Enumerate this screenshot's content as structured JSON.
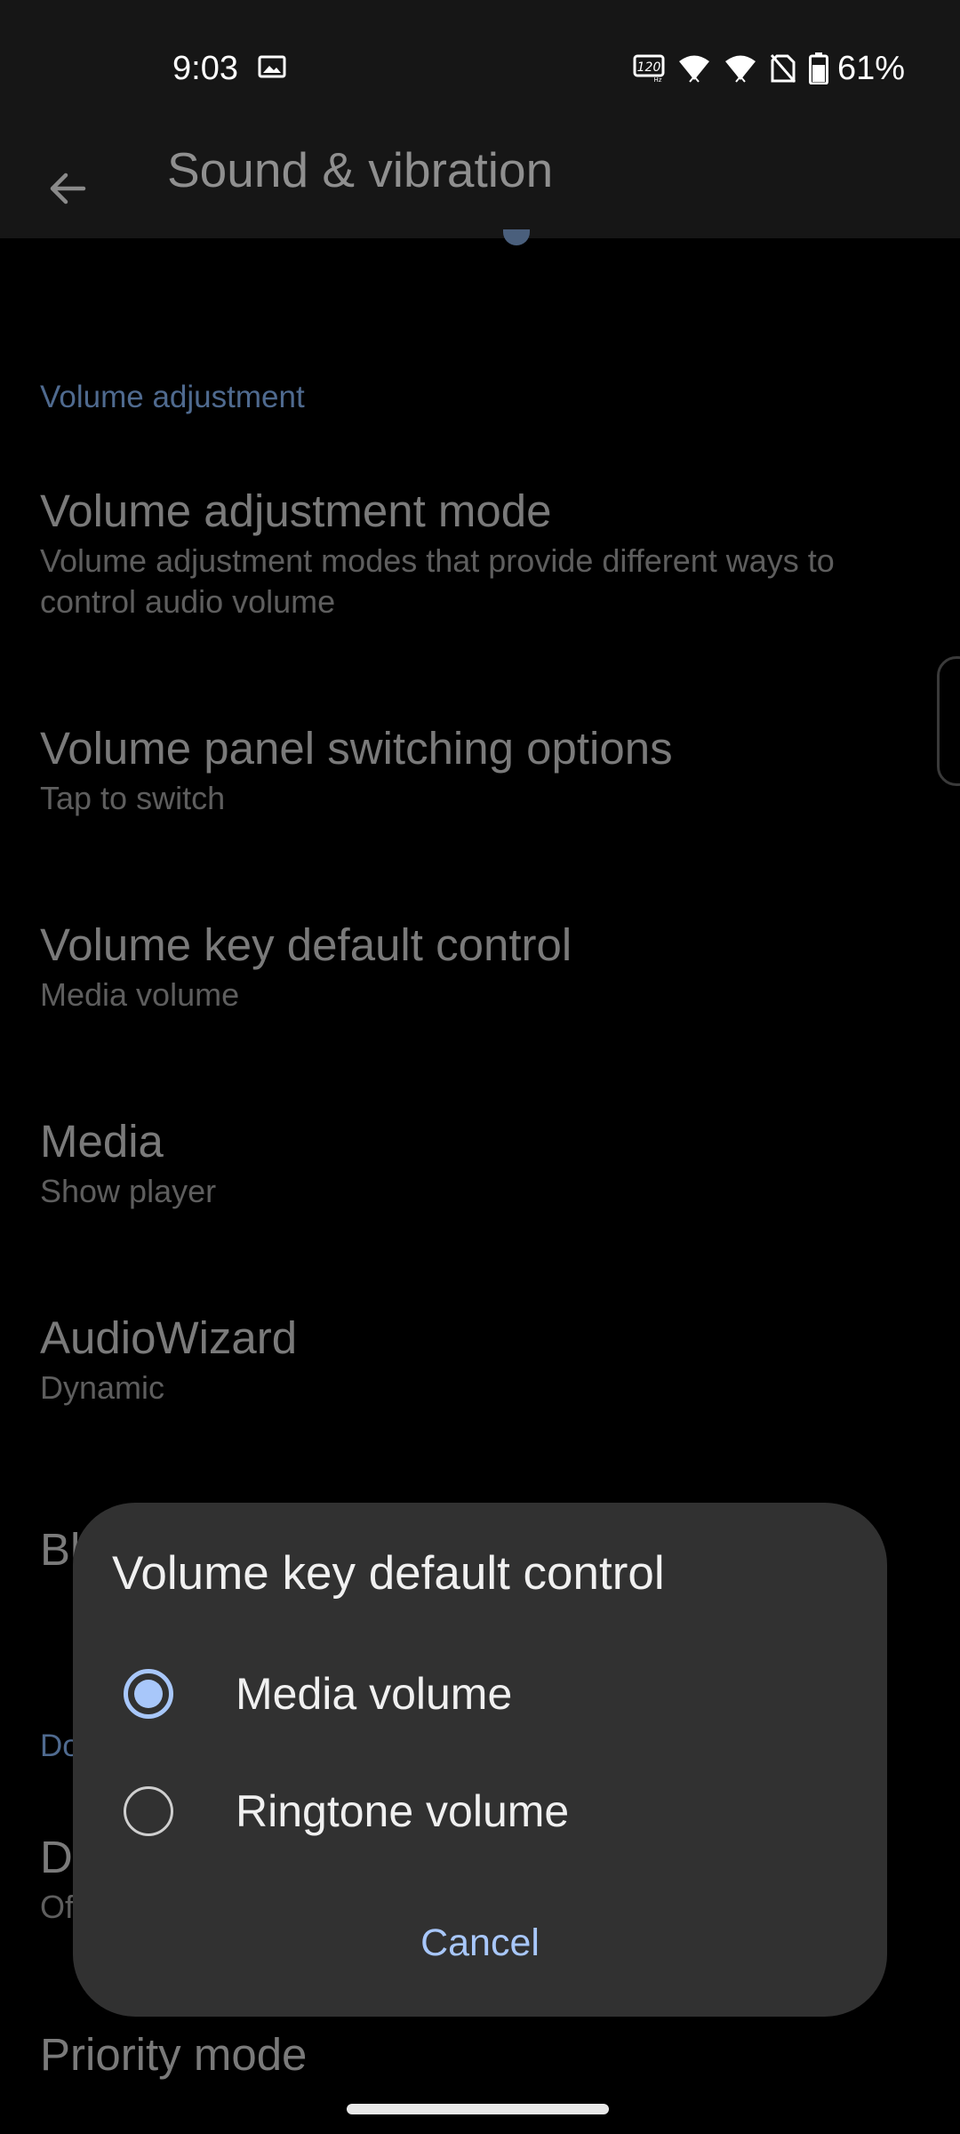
{
  "status_bar": {
    "time": "9:03",
    "battery": "61%",
    "icons": [
      "image-icon",
      "refresh-rate-120hz-icon",
      "wifi-icon",
      "wifi-icon",
      "no-sim-icon",
      "battery-icon"
    ]
  },
  "app_bar": {
    "title": "Sound & vibration",
    "back_icon": "arrow-back-icon"
  },
  "settings": {
    "section_volume": "Volume adjustment",
    "items": [
      {
        "title": "Volume adjustment mode",
        "summary": "Volume adjustment modes that provide different ways to control audio volume"
      },
      {
        "title": "Volume panel switching options",
        "summary": "Tap to switch"
      },
      {
        "title": "Volume key default control",
        "summary": "Media volume"
      },
      {
        "title": "Media",
        "summary": "Show player"
      },
      {
        "title": "AudioWizard",
        "summary": "Dynamic"
      },
      {
        "title": "Bl",
        "summary": ""
      },
      {
        "title": "D",
        "summary": "Of"
      },
      {
        "title": "Priority mode",
        "summary": ""
      }
    ],
    "section_do": "Do"
  },
  "dialog": {
    "title": "Volume key default control",
    "options": [
      {
        "label": "Media volume",
        "selected": true
      },
      {
        "label": "Ringtone volume",
        "selected": false
      }
    ],
    "cancel_label": "Cancel"
  },
  "colors": {
    "accent": "#a8c7fa",
    "section_header": "#4f6a8f",
    "dialog_bg": "#313131",
    "background": "#000000"
  }
}
